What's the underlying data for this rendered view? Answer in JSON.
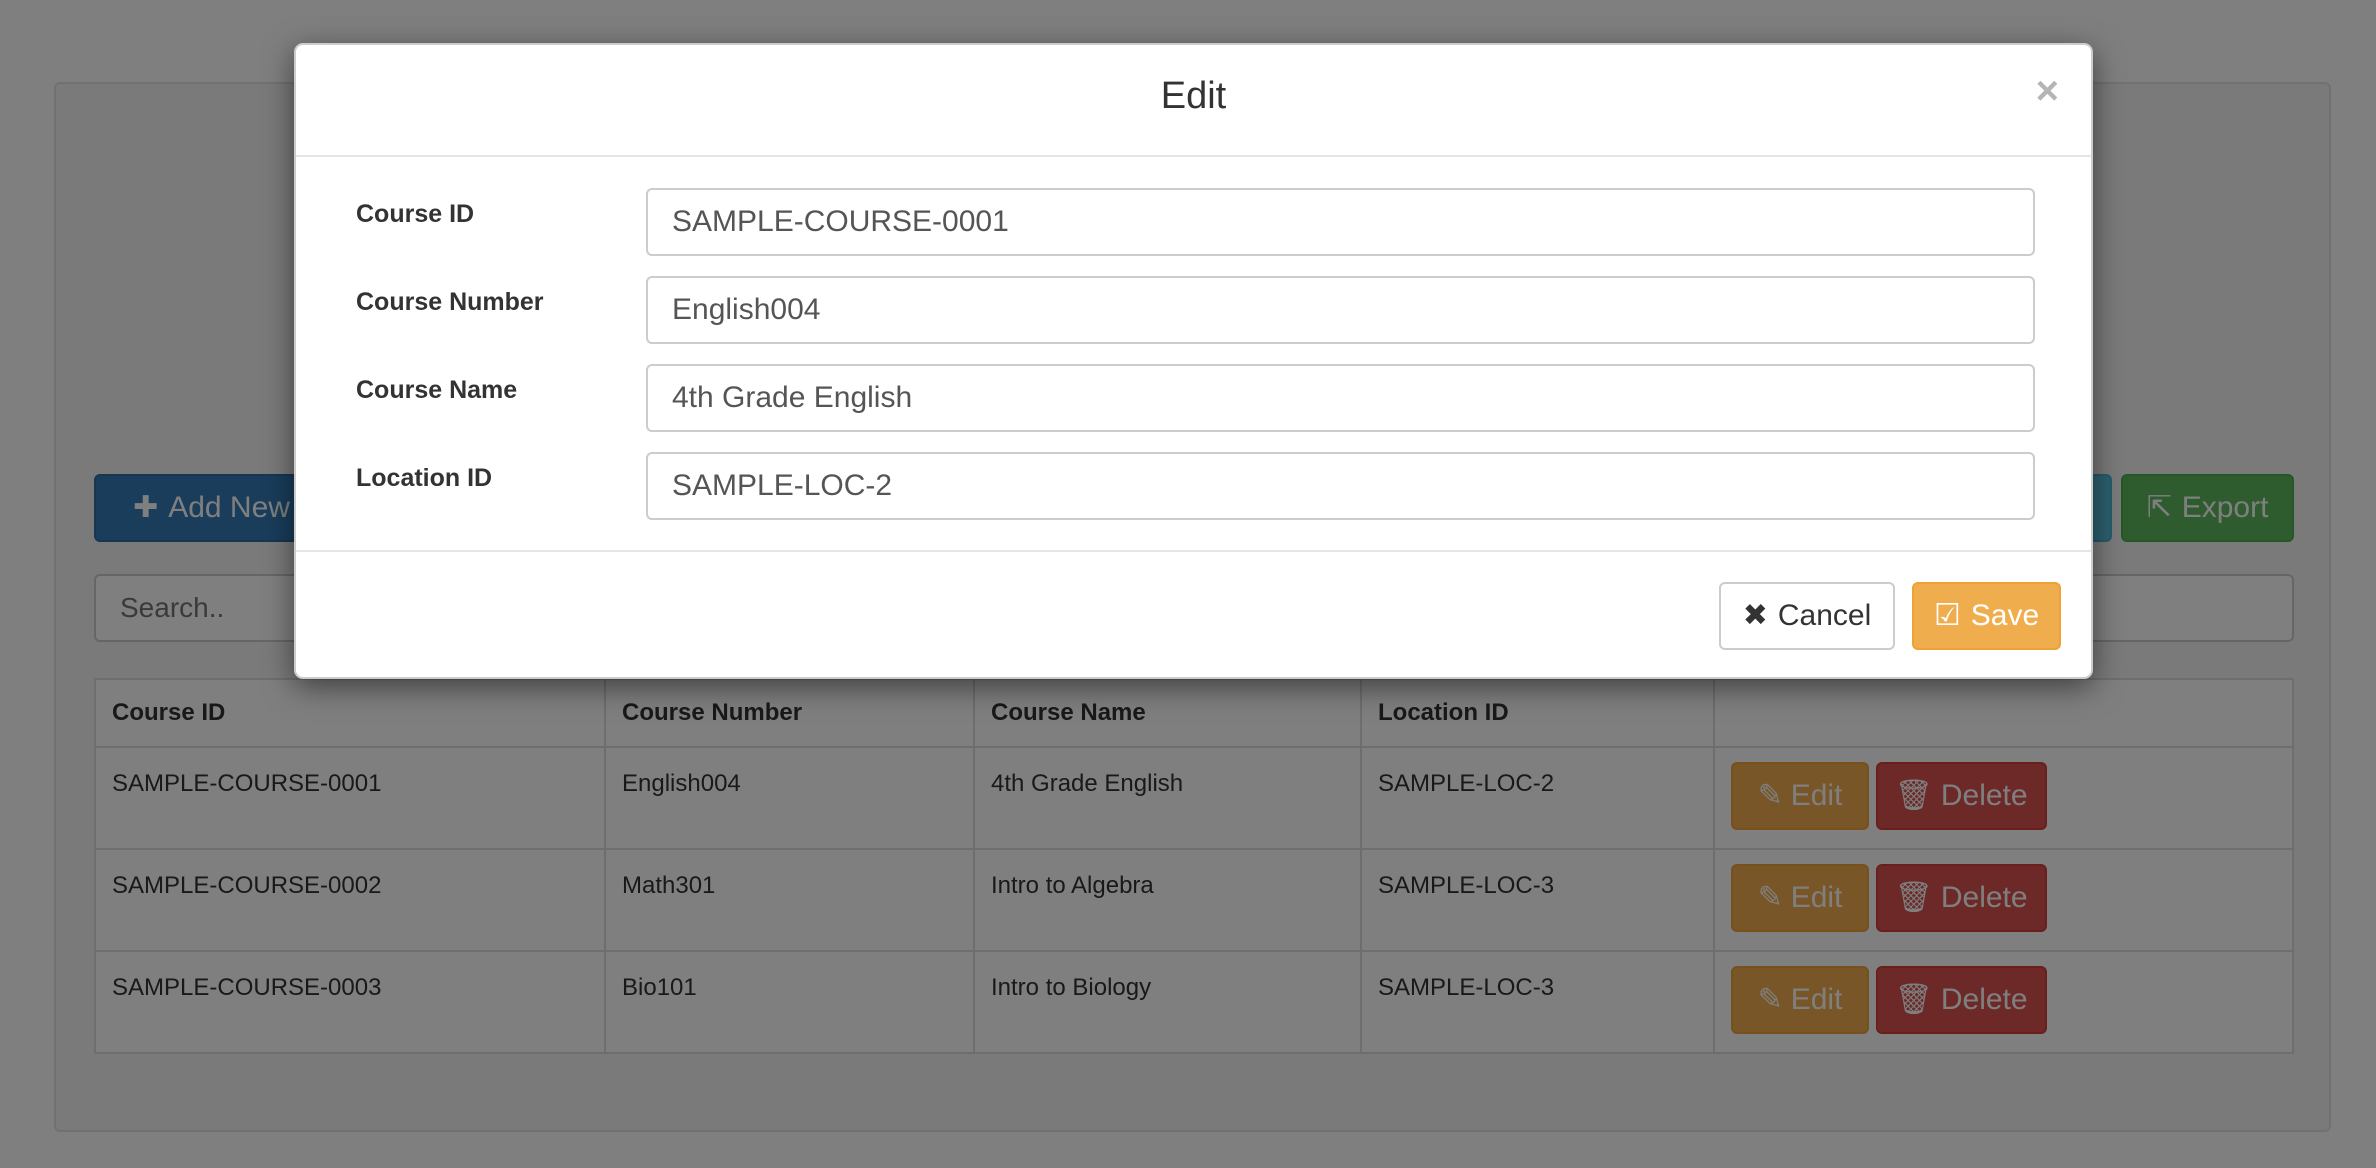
{
  "toolbar": {
    "add_new_label": "Add New",
    "export_label": "Export"
  },
  "search": {
    "placeholder": "Search.."
  },
  "table": {
    "headers": [
      "Course ID",
      "Course Number",
      "Course Name",
      "Location ID",
      ""
    ],
    "rows": [
      {
        "course_id": "SAMPLE-COURSE-0001",
        "course_number": "English004",
        "course_name": "4th Grade English",
        "location_id": "SAMPLE-LOC-2"
      },
      {
        "course_id": "SAMPLE-COURSE-0002",
        "course_number": "Math301",
        "course_name": "Intro to Algebra",
        "location_id": "SAMPLE-LOC-3"
      },
      {
        "course_id": "SAMPLE-COURSE-0003",
        "course_number": "Bio101",
        "course_name": "Intro to Biology",
        "location_id": "SAMPLE-LOC-3"
      }
    ],
    "edit_label": "Edit",
    "delete_label": "Delete"
  },
  "modal": {
    "title": "Edit",
    "close_glyph": "×",
    "fields": [
      {
        "label": "Course ID",
        "value": "SAMPLE-COURSE-0001"
      },
      {
        "label": "Course Number",
        "value": "English004"
      },
      {
        "label": "Course Name",
        "value": "4th Grade English"
      },
      {
        "label": "Location ID",
        "value": "SAMPLE-LOC-2"
      }
    ],
    "cancel_label": "Cancel",
    "save_label": "Save"
  },
  "icons": {
    "plus": "plus-icon",
    "export": "export-icon",
    "edit": "edit-icon",
    "trash": "trash-icon",
    "close": "close-icon",
    "check": "check-icon"
  },
  "colors": {
    "primary": "#337ab7",
    "success": "#5cb85c",
    "warning": "#f0ad4e",
    "danger": "#d9534f",
    "info": "#5bc0de"
  }
}
